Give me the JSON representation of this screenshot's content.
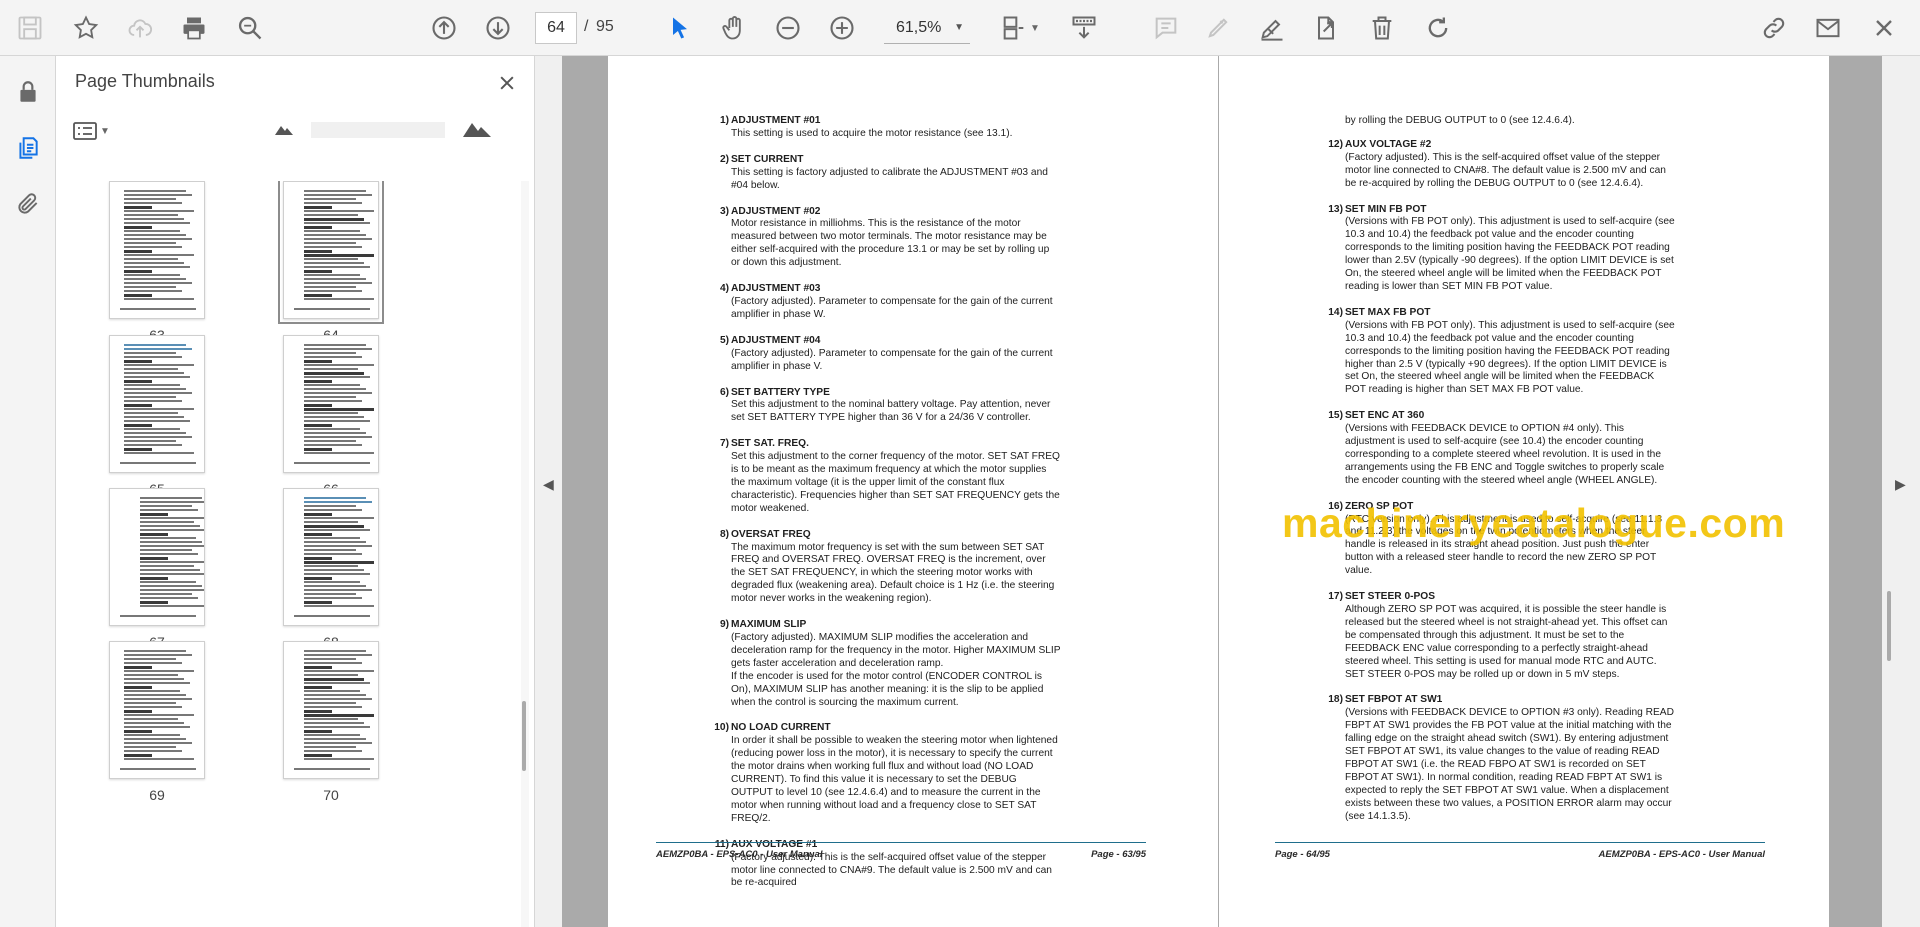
{
  "toolbar": {
    "page_current": "64",
    "page_separator": "/",
    "page_total": "95",
    "zoom": "61,5%",
    "icons": [
      "save-icon",
      "star-icon",
      "cloud-upload-icon",
      "print-icon",
      "zoom-search-icon",
      "page-up-icon",
      "page-down-icon",
      "select-cursor-icon",
      "hand-icon",
      "zoom-out-icon",
      "zoom-in-icon",
      "page-layout-icon",
      "scroll-mode-icon",
      "comment-icon",
      "highlight-icon",
      "sign-icon",
      "export-icon",
      "delete-icon",
      "rotate-icon",
      "share-link-icon",
      "email-icon",
      "close-icon"
    ]
  },
  "rail": {
    "icons": [
      "lock-icon",
      "page-thumbnails-icon",
      "attachments-icon"
    ]
  },
  "thumbnails": {
    "title": "Page Thumbnails",
    "items": [
      {
        "label": "63"
      },
      {
        "label": "64"
      },
      {
        "label": "65"
      },
      {
        "label": "66"
      },
      {
        "label": "67"
      },
      {
        "label": "68"
      },
      {
        "label": "69"
      },
      {
        "label": "70"
      }
    ],
    "selected": "64"
  },
  "page_left": {
    "items": [
      {
        "num": "1)",
        "title": "ADJUSTMENT #01",
        "body": "This setting is used to acquire the motor resistance (see 13.1)."
      },
      {
        "num": "2)",
        "title": "SET CURRENT",
        "body": "This setting is factory adjusted to calibrate the ADJUSTMENT #03 and #04 below."
      },
      {
        "num": "3)",
        "title": "ADJUSTMENT #02",
        "body": "Motor resistance in milliohms. This is the resistance of the motor measured between two motor terminals. The motor resistance may be either self-acquired with the procedure 13.1 or may be set by rolling up or down this adjustment."
      },
      {
        "num": "4)",
        "title": "ADJUSTMENT #03",
        "body": "(Factory adjusted). Parameter to compensate for the gain of the current amplifier in phase W."
      },
      {
        "num": "5)",
        "title": "ADJUSTMENT #04",
        "body": "(Factory adjusted). Parameter to compensate for the gain of the current amplifier in phase V."
      },
      {
        "num": "6)",
        "title": "SET BATTERY TYPE",
        "body": "Set this adjustment to the nominal battery voltage. Pay attention, never set SET BATTERY TYPE higher than 36 V for a 24/36 V controller."
      },
      {
        "num": "7)",
        "title": "SET SAT. FREQ.",
        "body": "Set this adjustment to the corner frequency of the motor. SET SAT FREQ is to be meant as the maximum frequency at which the motor supplies the maximum voltage (it is the upper limit of the constant flux characteristic). Frequencies higher than SET SAT FREQUENCY gets the motor weakened."
      },
      {
        "num": "8)",
        "title": "OVERSAT FREQ",
        "body": "The maximum motor frequency is set with the sum between SET SAT FREQ and OVERSAT FREQ. OVERSAT FREQ is the increment, over the SET SAT FREQUENCY, in which the steering motor works with degraded flux (weakening area). Default choice is 1 Hz (i.e. the steering motor never works in the weakening region)."
      },
      {
        "num": "9)",
        "title": "MAXIMUM SLIP",
        "body": "(Factory adjusted). MAXIMUM SLIP modifies the acceleration and deceleration ramp for the frequency in the motor. Higher MAXIMUM SLIP gets faster acceleration and deceleration ramp.",
        "body2": "If the encoder is used for the motor control (ENCODER CONTROL is On), MAXIMUM SLIP has another meaning: it is the slip to be applied when the control is sourcing the maximum current."
      },
      {
        "num": "10)",
        "title": "NO LOAD CURRENT",
        "body": "In order it shall be possible to weaken the steering motor when lightened (reducing power loss in the motor), it is necessary to specify the current the motor drains when working full flux and without load (NO LOAD CURRENT). To find this value it is necessary to set the DEBUG OUTPUT to level 10 (see 12.4.6.4) and to measure the current in the motor when running without load and a frequency close to SET SAT FREQ/2."
      },
      {
        "num": "11)",
        "title": "AUX VOLTAGE #1",
        "body": "(Factory adjusted). This is the self-acquired offset value of the stepper motor line connected to CNA#9. The default value is 2.500 mV and can be re-acquired"
      }
    ],
    "footer_left": "AEMZP0BA - EPS-AC0 - User Manual",
    "footer_right": "Page - 63/95"
  },
  "page_right": {
    "continuation": "by rolling the DEBUG OUTPUT to 0 (see 12.4.6.4).",
    "items": [
      {
        "num": "12)",
        "title": "AUX VOLTAGE #2",
        "body": "(Factory adjusted). This is the self-acquired offset value of the stepper motor line connected to CNA#8. The default value is 2.500 mV and can be re-acquired by rolling the DEBUG OUTPUT to 0 (see 12.4.6.4)."
      },
      {
        "num": "13)",
        "title": "SET MIN FB POT",
        "body": "(Versions with FB POT only). This adjustment is used to self-acquire (see 10.3 and 10.4) the feedback pot value and the encoder counting corresponds to the limiting position having the FEEDBACK POT reading lower than 2.5V (typically -90 degrees). If the option LIMIT DEVICE is set On, the steered wheel angle will be limited when the FEEDBACK POT reading is lower than SET MIN FB POT value."
      },
      {
        "num": "14)",
        "title": "SET MAX FB POT",
        "body": "(Versions with FB POT only). This adjustment is used to self-acquire (see 10.3 and 10.4) the feedback pot value and the encoder counting corresponds to the limiting position having the FEEDBACK POT reading higher than 2.5 V (typically +90 degrees). If the option LIMIT DEVICE is set On, the steered wheel angle will be limited when the FEEDBACK POT reading is higher than SET MAX FB POT value."
      },
      {
        "num": "15)",
        "title": "SET ENC AT 360",
        "body": "(Versions with FEEDBACK DEVICE to OPTION #4 only). This adjustment is used to self-acquire (see 10.4) the encoder counting corresponding to a complete steered wheel revolution. It is used in the arrangements using the FB ENC and Toggle switches to properly scale the encoder counting with the steered wheel angle (WHEEL ANGLE)."
      },
      {
        "num": "16)",
        "title": "ZERO SP POT",
        "body": "(RTC version only). This adjustment is used to self-acquire (see 11.1.3 and 11.2.3) the voltages on the twin potentiometers when the steer handle is released in its straight ahead position. Just push the enter button with a released steer handle to record the new ZERO SP POT value."
      },
      {
        "num": "17)",
        "title": "SET STEER 0-POS",
        "body": "Although ZERO SP POT was acquired, it is possible the steer handle is released but the steered wheel is not straight-ahead yet. This offset can be compensated through this adjustment. It must be set to the FEEDBACK ENC value corresponding to a perfectly straight-ahead steered wheel. This setting is used for manual mode RTC and AUTC.",
        "body2": "SET STEER 0-POS may be rolled up or down in 5 mV steps."
      },
      {
        "num": "18)",
        "title": "SET FBPOT AT SW1",
        "body": "(Versions with FEEDBACK DEVICE to OPTION #3 only). Reading READ FBPT AT SW1 provides the FB POT value at the initial matching with the falling edge on the straight ahead switch (SW1). By entering adjustment SET FBPOT AT SW1, its value changes to the value of reading READ FBPOT AT SW1 (i.e. the READ FBPO AT SW1 is recorded on SET FBPOT AT SW1). In normal condition, reading READ FBPT AT SW1 is expected to reply the SET FBPOT AT SW1 value. When a displacement exists between these two values, a POSITION ERROR alarm may occur (see 14.1.3.5)."
      }
    ],
    "footer_left": "Page - 64/95",
    "footer_right": "AEMZP0BA - EPS-AC0 - User Manual"
  },
  "watermark": "machineryeatalogue.com"
}
